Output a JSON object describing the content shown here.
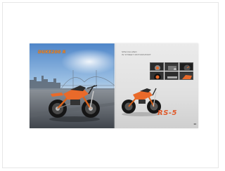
{
  "brochure": {
    "left_page": {
      "headline": "DUKE200 R"
    },
    "right_page": {
      "tagline_lines": [
        "SPECIALIZED",
        "IN STREET MOTORSPORT"
      ],
      "model_name": "RS-5",
      "page_number": "02"
    }
  },
  "colors": {
    "accent_orange": "#e96a2a",
    "sky_blue": "#6fa3d6",
    "bike_frame_orange": "#d8631e"
  }
}
